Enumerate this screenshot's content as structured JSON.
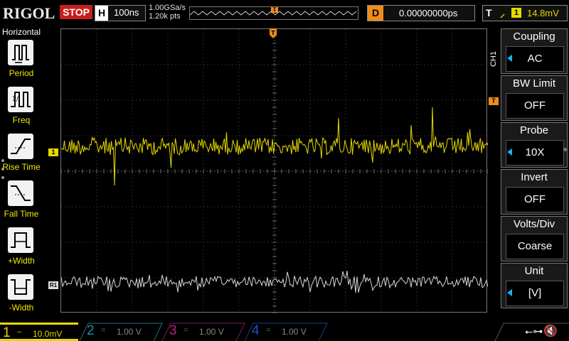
{
  "top_bar": {
    "brand": "RIGOL",
    "run_state": "STOP",
    "horizontal_label": "H",
    "timebase": "100ns",
    "sample_rate": "1.00GSa/s",
    "memory_depth": "1.20k pts",
    "delay_label": "D",
    "delay_value": "0.00000000ps",
    "trigger_label": "T",
    "trigger_channel": "1",
    "trigger_level": "14.8mV"
  },
  "left_panel": {
    "title": "Horizontal",
    "items": [
      {
        "label": "Period",
        "icon": "period-icon"
      },
      {
        "label": "Freq",
        "icon": "frequency-icon"
      },
      {
        "label": "Rise Time",
        "icon": "rise-time-icon"
      },
      {
        "label": "Fall Time",
        "icon": "fall-time-icon"
      },
      {
        "label": "+Width",
        "icon": "positive-width-icon"
      },
      {
        "label": "-Width",
        "icon": "negative-width-icon"
      }
    ]
  },
  "markers": {
    "trigger_position": "T",
    "ch1": "1",
    "ref1": "R1",
    "trigger_level": "T"
  },
  "right_menu": {
    "channel_tag": "CH1",
    "items": [
      {
        "label": "Coupling",
        "value": "AC"
      },
      {
        "label": "BW Limit",
        "value": "OFF"
      },
      {
        "label": "Probe",
        "value": "10X"
      },
      {
        "label": "Invert",
        "value": "OFF"
      },
      {
        "label": "Volts/Div",
        "value": "Coarse"
      },
      {
        "label": "Unit",
        "value": "[V]"
      }
    ]
  },
  "bottom_bar": {
    "channels": [
      {
        "num": "1",
        "coupling": "~",
        "scale": "10.0mV",
        "color": "#e6d800"
      },
      {
        "num": "2",
        "coupling": "=",
        "scale": "1.00 V",
        "color": "#1a8fa0"
      },
      {
        "num": "3",
        "coupling": "=",
        "scale": "1.00 V",
        "color": "#b0248a"
      },
      {
        "num": "4",
        "coupling": "=",
        "scale": "1.00 V",
        "color": "#2050c0"
      }
    ],
    "usb_icon": "usb-icon",
    "speaker_icon": "speaker-muted-icon"
  },
  "colors": {
    "ch1": "#e6d800",
    "ref": "#d8d8d8",
    "trigger": "#f08c1a",
    "stop": "#c81e1e",
    "grid": "#5a5a5a"
  }
}
